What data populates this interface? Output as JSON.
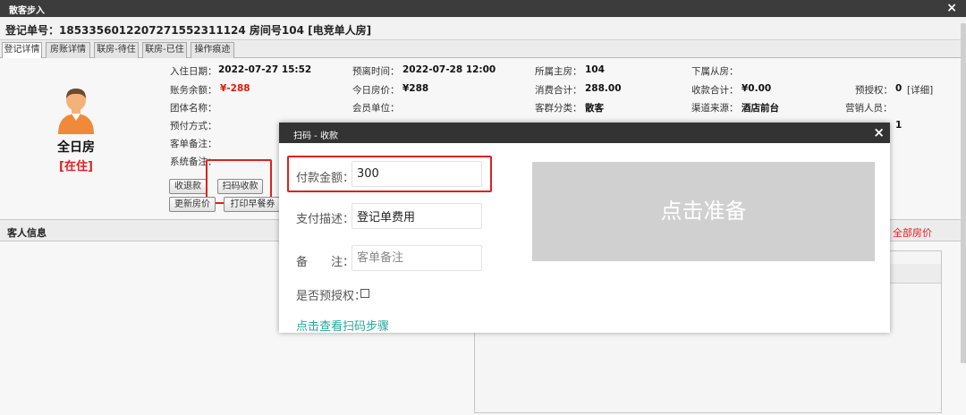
{
  "window": {
    "title": "散客步入",
    "close": "×"
  },
  "registration": {
    "header": "登记单号：1853356012207271552311124 房间号104 [电竞单人房]"
  },
  "tabs": [
    "登记详情",
    "房账详情",
    "联房-待住",
    "联房-已住",
    "操作痕迹"
  ],
  "room": {
    "type": "全日房",
    "status": "[在住]"
  },
  "fields": {
    "checkin_label": "入住日期：",
    "checkin_value": "2022-07-27 15:52",
    "balance_label": "账务余额：",
    "balance_value": "¥-288",
    "group_label": "团体名称：",
    "prepay_label": "预付方式：",
    "guestnote_label": "客单备注：",
    "sysnote_label": "系统备注：",
    "departure_label": "预离时间：",
    "departure_value": "2022-07-28 12:00",
    "todayprice_label": "今日房价：",
    "todayprice_value": "¥288",
    "member_label": "会员单位：",
    "mainroom_label": "所属主房：",
    "mainroom_value": "104",
    "consume_label": "消费合计：",
    "consume_value": "288.00",
    "guestclass_label": "客群分类：",
    "guestclass_value": "散客",
    "subroom_label": "下属从房：",
    "received_label": "收款合计：",
    "received_value": "¥0.00",
    "channel_label": "渠道来源：",
    "channel_value": "酒店前台",
    "preauth_label": "预授权：",
    "preauth_value": "0",
    "preauth_detail": "[详细]",
    "sales_label": "营销人员：",
    "guestcount_value": "1"
  },
  "buttons": [
    "收退款",
    "扫码收款",
    "更新房价",
    "打印早餐券"
  ],
  "guest_section": {
    "title": "客人信息",
    "all_prices": "全部房价"
  },
  "dialog": {
    "title": "扫码 - 收款",
    "close": "×",
    "amount_label": "付款金额：",
    "amount_value": "300",
    "desc_label": "支付描述：",
    "desc_value": "登记单费用",
    "note_label": "备　　注：",
    "note_placeholder": "客单备注",
    "preauth_label": "是否预授权：",
    "steps_link": "点击查看扫码步骤",
    "qr_text": "点击准备"
  }
}
